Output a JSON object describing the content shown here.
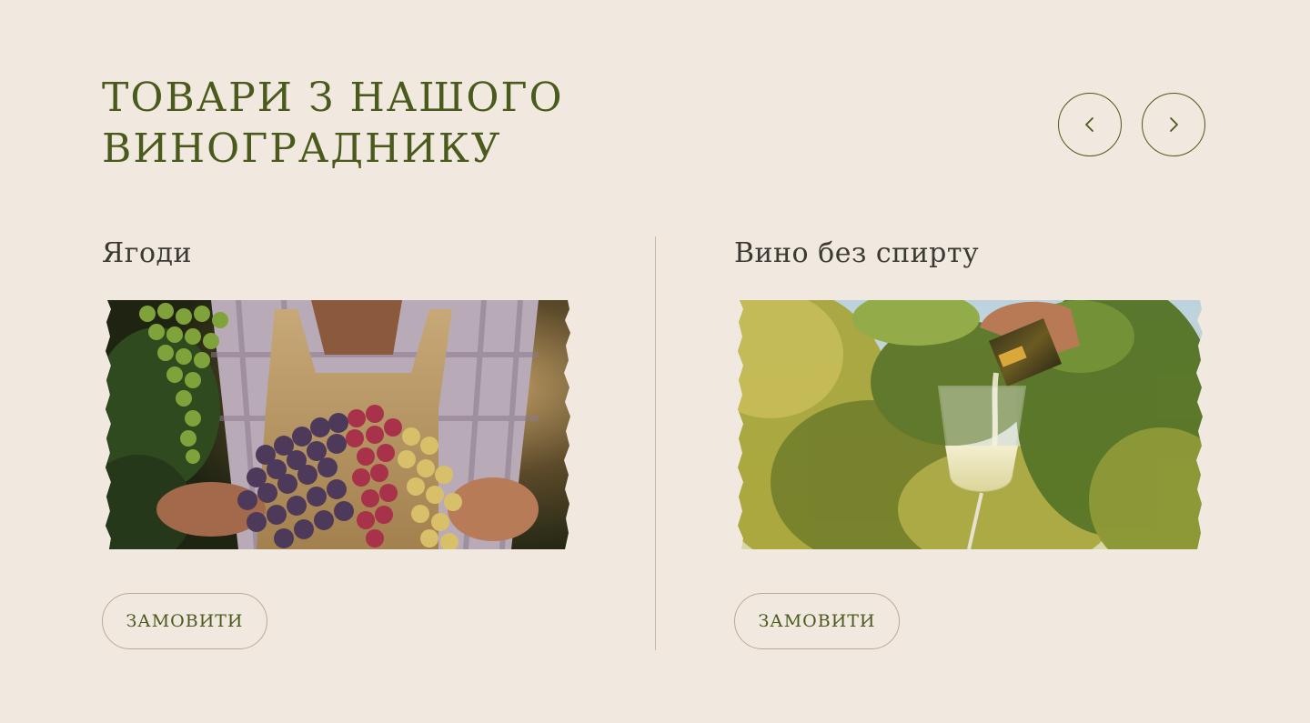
{
  "section": {
    "title_line1": "ТОВАРИ З НАШОГО",
    "title_line2": "ВИНОГРАДНИКУ"
  },
  "nav": {
    "prev_icon": "chevron-left-icon",
    "next_icon": "chevron-right-icon"
  },
  "products": [
    {
      "name": "Ягоди",
      "image": "grapes-harvest-photo",
      "button_label": "ЗАМОВИТИ"
    },
    {
      "name": "Вино без спирту",
      "image": "wine-pouring-photo",
      "button_label": "ЗАМОВИТИ"
    }
  ],
  "colors": {
    "background": "#f1e8df",
    "accent": "#4a5a1c",
    "text": "#3a3a33",
    "border": "#b9ab98"
  }
}
